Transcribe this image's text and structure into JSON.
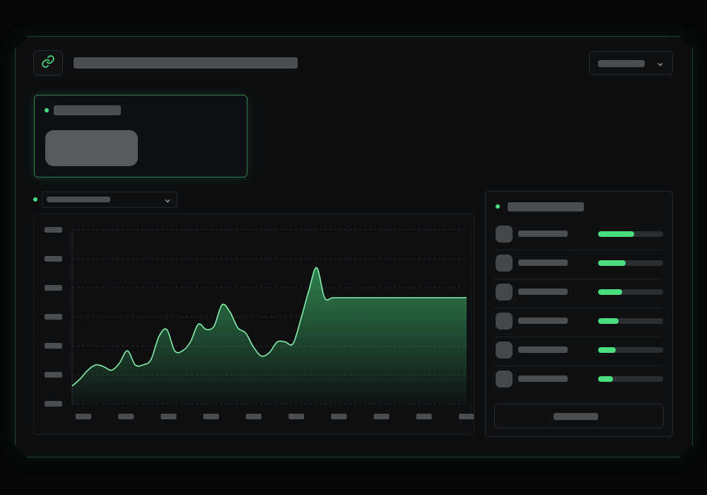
{
  "header": {
    "link_icon": "link-icon",
    "title_text": "",
    "period_select": {
      "value": "",
      "icon": "chevron-down-icon"
    }
  },
  "kpi_card": {
    "status_color": "#4ade80",
    "label": "",
    "value": ""
  },
  "chart": {
    "metric_select": {
      "value": "",
      "icon": "chevron-down-icon"
    },
    "accent_color": "#4ade80"
  },
  "chart_data": {
    "type": "area",
    "title": "",
    "xlabel": "",
    "ylabel": "",
    "x_tick_labels": [
      "",
      "",
      "",
      "",
      "",
      "",
      "",
      "",
      "",
      ""
    ],
    "y_tick_labels": [
      "",
      "",
      "",
      "",
      "",
      "",
      ""
    ],
    "grid": true,
    "x": [
      0,
      1,
      2,
      3,
      4,
      5,
      6,
      7,
      8,
      9,
      10,
      11,
      12,
      13,
      14,
      15,
      16,
      17,
      18,
      19,
      20,
      21,
      22,
      23,
      24,
      25,
      26,
      27,
      28,
      29,
      30,
      31,
      32,
      33,
      34,
      35,
      36,
      37,
      38,
      39,
      40,
      41,
      42,
      43,
      44,
      45,
      46,
      47,
      48,
      49,
      50
    ],
    "series": [
      {
        "values": [
          10,
          14,
          19,
          22,
          21,
          19,
          23,
          30,
          22,
          22,
          25,
          38,
          42,
          30,
          30,
          35,
          45,
          42,
          44,
          56,
          52,
          43,
          40,
          32,
          27,
          29,
          35,
          35,
          34,
          48,
          64,
          77,
          60,
          60,
          60,
          60,
          60,
          60,
          60,
          60,
          60,
          60,
          60,
          60,
          60,
          60,
          60,
          60,
          60,
          60,
          60
        ]
      }
    ],
    "ylim": [
      0,
      100
    ]
  },
  "leaderboard": {
    "title": "",
    "status_color": "#4ade80",
    "rows": [
      {
        "name": "",
        "progress": 0.55
      },
      {
        "name": "",
        "progress": 0.42
      },
      {
        "name": "",
        "progress": 0.37
      },
      {
        "name": "",
        "progress": 0.31
      },
      {
        "name": "",
        "progress": 0.27
      },
      {
        "name": "",
        "progress": 0.23
      }
    ],
    "button_label": ""
  }
}
